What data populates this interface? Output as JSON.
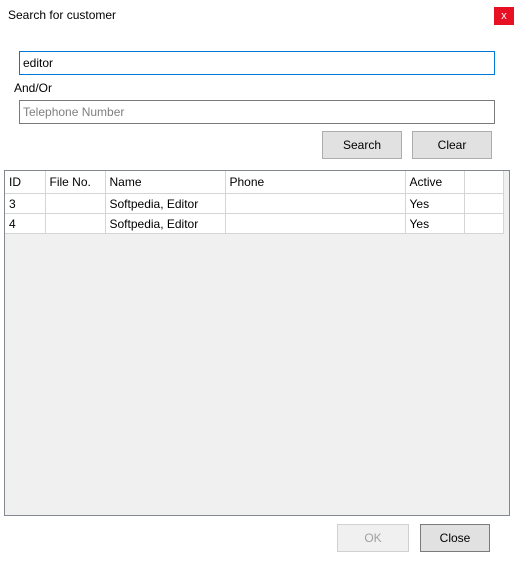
{
  "window": {
    "title": "Search for customer",
    "close_glyph": "x"
  },
  "search": {
    "name_value": "editor",
    "conjunction_label": "And/Or",
    "phone_placeholder": "Telephone Number",
    "search_label": "Search",
    "clear_label": "Clear"
  },
  "results": {
    "columns": [
      "ID",
      "File No.",
      "Name",
      "Phone",
      "Active"
    ],
    "rows": [
      {
        "id": "3",
        "file_no": "",
        "name": "Softpedia, Editor",
        "phone": "",
        "active": "Yes"
      },
      {
        "id": "4",
        "file_no": "",
        "name": "Softpedia, Editor",
        "phone": "",
        "active": "Yes"
      }
    ]
  },
  "footer": {
    "ok_label": "OK",
    "close_label": "Close"
  },
  "colors": {
    "close_button_bg": "#e81123",
    "focused_border": "#0078d7",
    "grid_background": "#f0f0f0"
  }
}
